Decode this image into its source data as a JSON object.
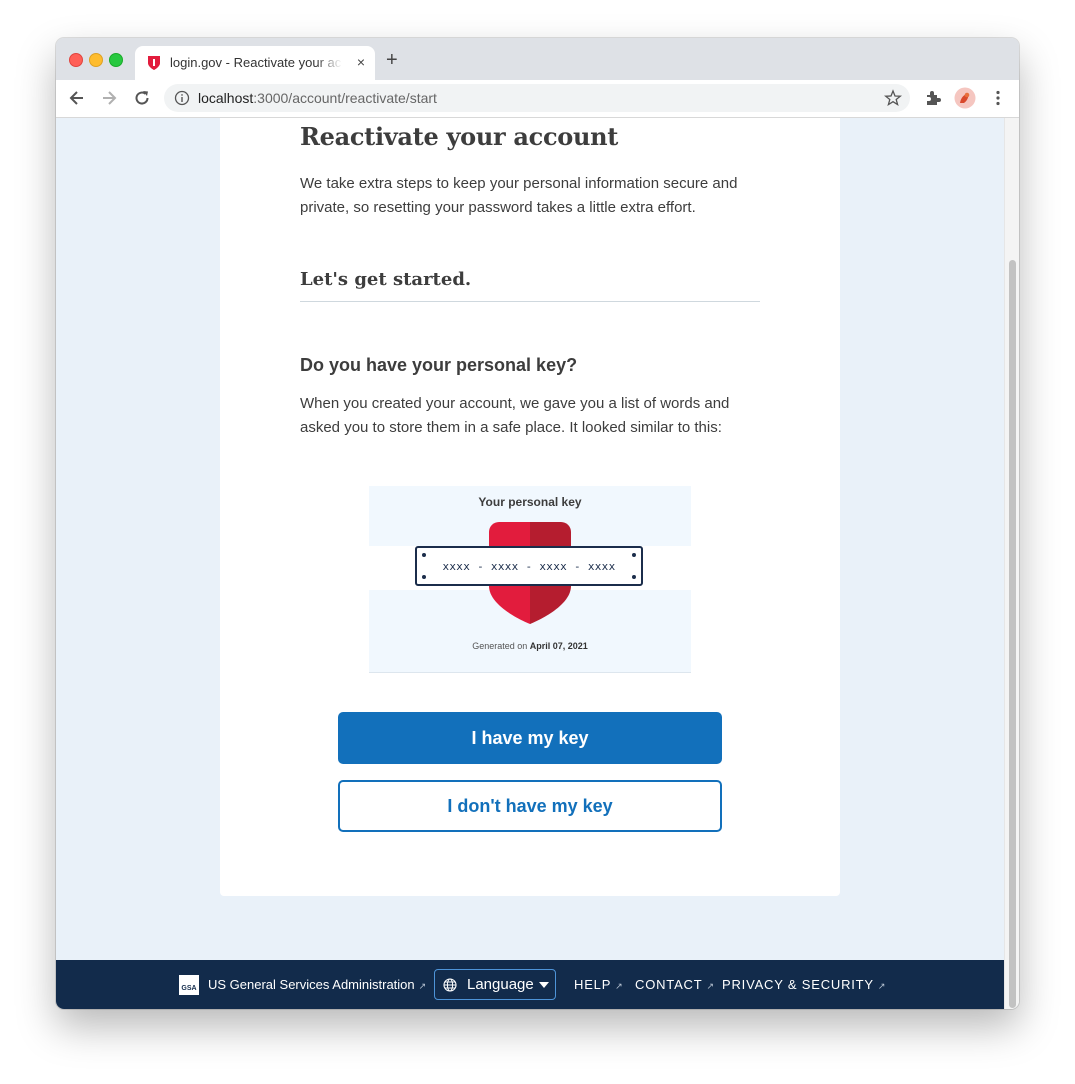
{
  "browser": {
    "tab_title": "login.gov - Reactivate your account",
    "tab_close": "×",
    "new_tab": "+",
    "url_host": "localhost",
    "url_rest": ":3000/account/reactivate/start"
  },
  "page": {
    "title": "Reactivate your account",
    "intro": "We take extra steps to keep your personal information secure and private, so resetting your password takes a little extra effort.",
    "subtitle": "Let's get started.",
    "question": "Do you have your personal key?",
    "explanation": "When you created your account, we gave you a list of words and asked you to store them in a safe place. It looked similar to this:"
  },
  "key_illustration": {
    "title": "Your personal key",
    "code": "xxxx - xxxx - xxxx - xxxx",
    "generated_prefix": "Generated on ",
    "generated_date": "April 07, 2021"
  },
  "actions": {
    "primary": "I have my key",
    "secondary": "I don't have my key"
  },
  "footer": {
    "gsa_logo_text": "GSA",
    "agency": "US General Services Administration",
    "language": "Language",
    "help": "HELP",
    "contact": "CONTACT",
    "privacy": "PRIVACY & SECURITY"
  },
  "colors": {
    "primary_blue": "#1270bb",
    "footer_navy": "#122b4b",
    "page_bg": "#e9f1f9",
    "shield_red": "#e21c3d"
  },
  "icons": [
    "shield-favicon-icon",
    "back-arrow-icon",
    "forward-arrow-icon",
    "reload-icon",
    "info-icon",
    "star-icon",
    "extensions-icon",
    "profile-avatar-icon",
    "menu-kebab-icon",
    "globe-icon",
    "external-link-icon"
  ]
}
